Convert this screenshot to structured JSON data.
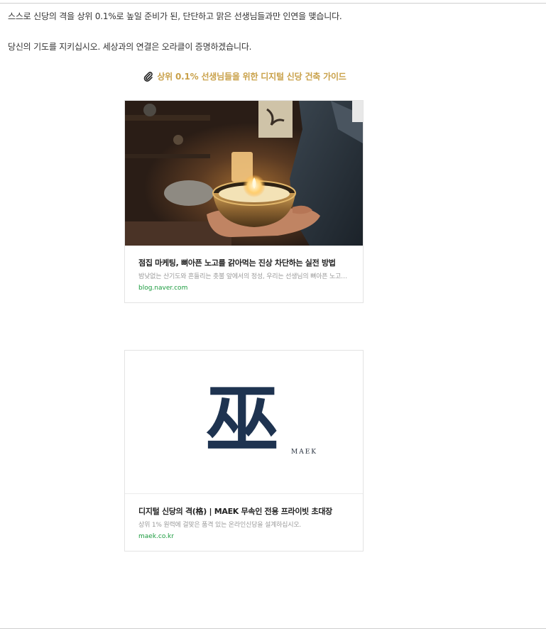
{
  "content": {
    "paragraph_1": "스스로 신당의 격을 상위 0.1%로 높일 준비가 된, 단단하고 맑은 선생님들과만 인연을 맺습니다.",
    "paragraph_2": "당신의 기도를 지키십시오. 세상과의 연결은 오라클이 증명하겠습니다.",
    "guide_link": "상위 0.1% 선생님들을 위한 디지털 신당 건축 가이드"
  },
  "cards": [
    {
      "title": "점집 마케팅, 뼈아픈 노고를 갉아먹는 진상 차단하는 실전 방법",
      "description": "밤낮없는 산기도와 흔들리는 촛불 앞에서의 정성, 우리는 선생님의 뼈아픈 노고를 존중합니다",
      "host": "blog.naver.com",
      "image_icon": "singing-bowl-candle-photo"
    },
    {
      "title": "디지털 신당의 격(格) | MAEK 무속인 전용 프라이빗 초대장",
      "description": "상위 1% 원력에 걸맞은 품격 있는 온라인신당을 설계하십시오.",
      "host": "maek.co.kr",
      "logo_glyph": "巫",
      "logo_wordmark": "MAEK"
    }
  ],
  "colors": {
    "guide_link": "#c9a14a",
    "host_link": "#1a9b3e",
    "logo_navy": "#1e3350"
  },
  "icons": {
    "guide_prefix": "paperclip-icon"
  }
}
